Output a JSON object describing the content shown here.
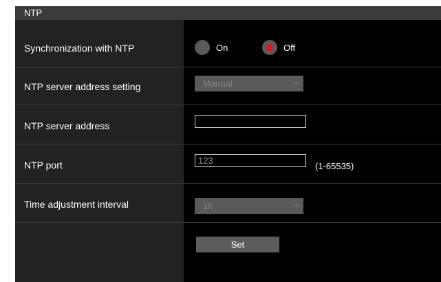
{
  "section": {
    "title": "NTP"
  },
  "rows": {
    "sync": {
      "label": "Synchronization with NTP",
      "options": [
        {
          "label": "On",
          "selected": false
        },
        {
          "label": "Off",
          "selected": true
        }
      ]
    },
    "server_setting": {
      "label": "NTP server address setting",
      "value": "Manual"
    },
    "server_address": {
      "label": "NTP server address",
      "value": ""
    },
    "port": {
      "label": "NTP port",
      "value": "123",
      "hint": "(1-65535)"
    },
    "interval": {
      "label": "Time adjustment interval",
      "value": "1h"
    }
  },
  "actions": {
    "set_label": "Set"
  },
  "colors": {
    "header_bg": "#3b3b3b",
    "label_bg": "#222222",
    "content_bg": "#000000",
    "radio_selected": "#e0161a",
    "control_bg": "#5a5a5a"
  },
  "icons": {
    "select_arrow": "chevron-down-icon"
  }
}
